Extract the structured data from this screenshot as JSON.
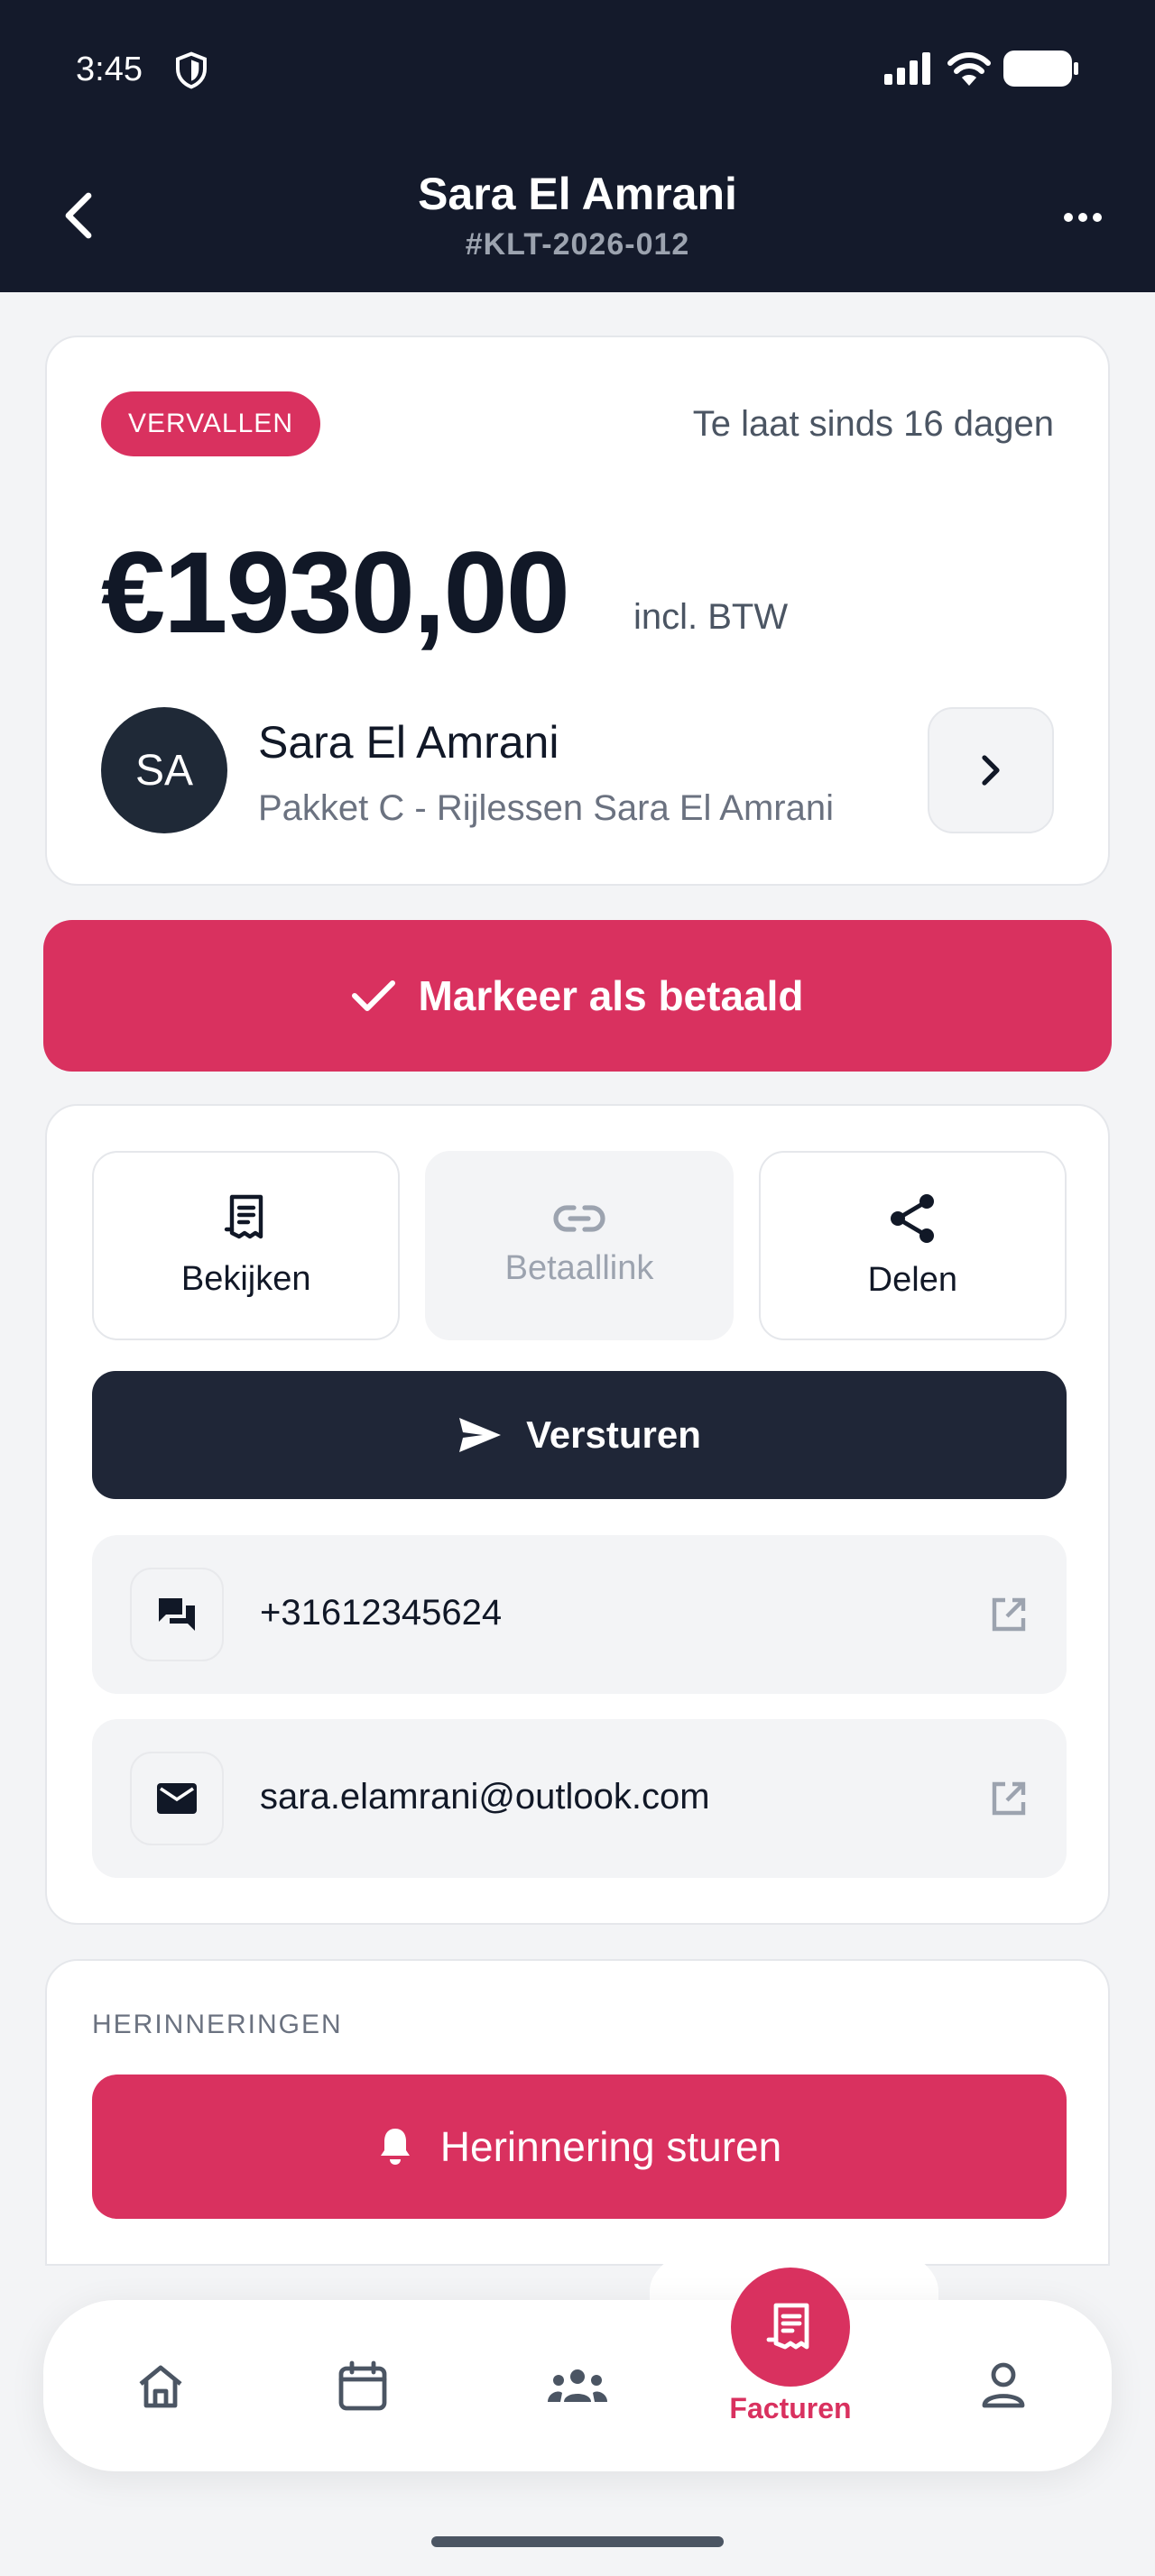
{
  "status_bar": {
    "time": "3:45"
  },
  "header": {
    "title": "Sara El Amrani",
    "subtitle": "#KLT-2026-012"
  },
  "invoice": {
    "status_badge": "VERVALLEN",
    "overdue_text": "Te laat sinds 16 dagen",
    "amount": "€1930,00",
    "amount_suffix": "incl. BTW",
    "client": {
      "initials": "SA",
      "name": "Sara El Amrani",
      "description": "Pakket C - Rijlessen Sara El Amrani"
    }
  },
  "actions": {
    "mark_paid": "Markeer als betaald",
    "tiles": [
      {
        "label": "Bekijken",
        "icon": "receipt-icon",
        "disabled": false
      },
      {
        "label": "Betaallink",
        "icon": "link-icon",
        "disabled": true
      },
      {
        "label": "Delen",
        "icon": "share-icon",
        "disabled": false
      }
    ],
    "send": "Versturen",
    "phone": "+31612345624",
    "email": "sara.elamrani@outlook.com"
  },
  "reminders": {
    "section_label": "HERINNERINGEN",
    "button": "Herinnering sturen"
  },
  "bottom_nav": {
    "items": [
      "home-icon",
      "calendar-icon",
      "people-icon",
      "invoice-icon",
      "person-icon"
    ],
    "active_label": "Facturen"
  },
  "colors": {
    "accent": "#d9315f",
    "header_bg": "#141a2b",
    "dark_button": "#1f2637"
  }
}
